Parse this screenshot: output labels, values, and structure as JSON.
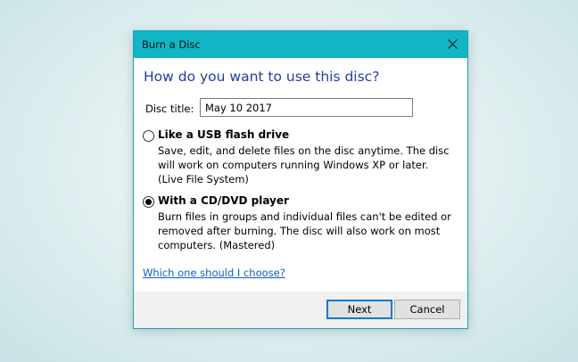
{
  "dialog": {
    "title": "Burn a Disc",
    "heading": "How do you want to use this disc?",
    "disc_title_label": "Disc title:",
    "disc_title_value": "May 10 2017",
    "options": [
      {
        "title": "Like a USB flash drive",
        "description": "Save, edit, and delete files on the disc anytime. The disc will work on computers running Windows XP or later. (Live File System)",
        "selected": false
      },
      {
        "title": "With a CD/DVD player",
        "description": "Burn files in groups and individual files can't be edited or removed after burning. The disc will also work on most computers. (Mastered)",
        "selected": true
      }
    ],
    "help_link": "Which one should I choose?",
    "buttons": {
      "next": "Next",
      "cancel": "Cancel"
    }
  },
  "icons": {
    "close": "close-icon"
  },
  "colors": {
    "titlebar": "#10b5c6",
    "heading": "#1e3fa4",
    "link": "#0b5fc3",
    "default_button_border": "#0078d7"
  }
}
